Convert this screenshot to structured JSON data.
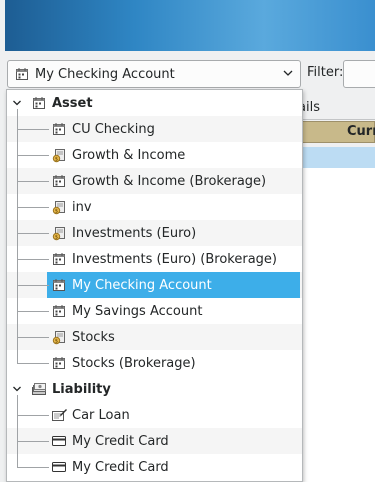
{
  "account_selector": {
    "value": "My Checking Account"
  },
  "filter": {
    "label": "Filter:",
    "value": ""
  },
  "background": {
    "column_header_partial": "ails",
    "column_header2_partial": "Curr"
  },
  "tree": {
    "groups": [
      {
        "label": "Asset",
        "icon": "ledger-icon",
        "items": [
          {
            "label": "CU Checking",
            "icon": "ledger-icon"
          },
          {
            "label": "Growth & Income",
            "icon": "investment-icon"
          },
          {
            "label": "Growth & Income (Brokerage)",
            "icon": "ledger-icon"
          },
          {
            "label": "inv",
            "icon": "investment-icon"
          },
          {
            "label": "Investments (Euro)",
            "icon": "investment-icon"
          },
          {
            "label": "Investments (Euro) (Brokerage)",
            "icon": "ledger-icon"
          },
          {
            "label": "My Checking Account",
            "icon": "ledger-icon",
            "selected": true
          },
          {
            "label": "My Savings Account",
            "icon": "ledger-icon"
          },
          {
            "label": "Stocks",
            "icon": "investment-icon"
          },
          {
            "label": "Stocks (Brokerage)",
            "icon": "ledger-icon"
          }
        ]
      },
      {
        "label": "Liability",
        "icon": "cash-stack-icon",
        "items": [
          {
            "label": "Car Loan",
            "icon": "loan-icon"
          },
          {
            "label": "My Credit Card",
            "icon": "credit-card-icon"
          },
          {
            "label": "My Credit Card",
            "icon": "credit-card-icon"
          }
        ]
      }
    ]
  },
  "colors": {
    "selection": "#3daee9",
    "banner": "#2f86c4",
    "header_bg": "#c8b98a",
    "row_highlight": "#bcdcf3"
  }
}
